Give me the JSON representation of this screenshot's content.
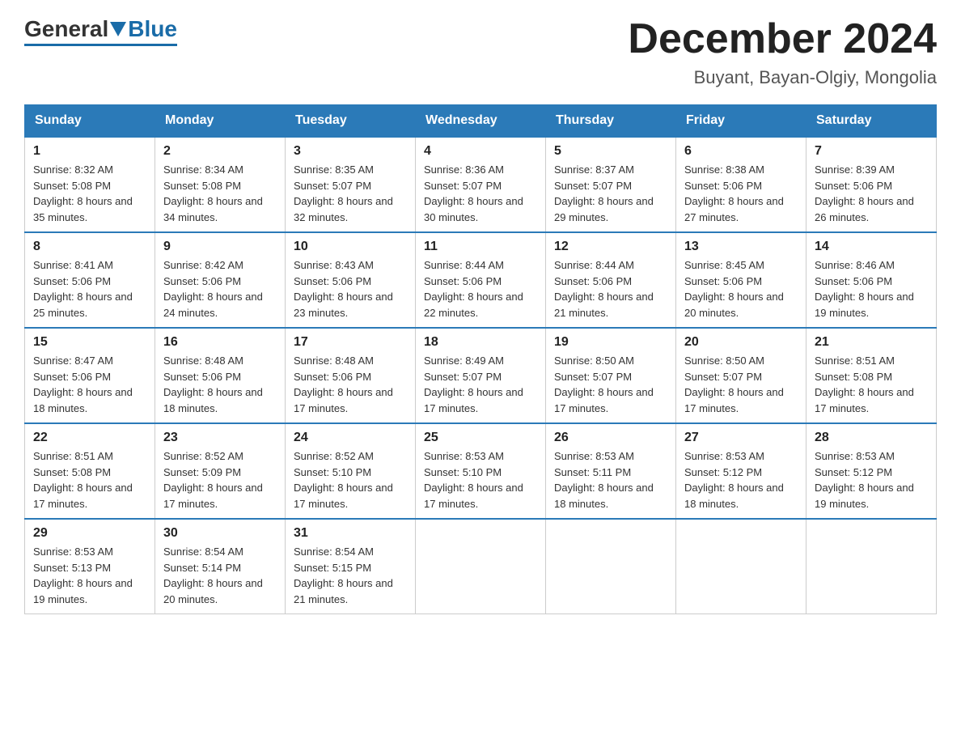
{
  "logo": {
    "general": "General",
    "blue": "Blue"
  },
  "title": "December 2024",
  "subtitle": "Buyant, Bayan-Olgiy, Mongolia",
  "days_of_week": [
    "Sunday",
    "Monday",
    "Tuesday",
    "Wednesday",
    "Thursday",
    "Friday",
    "Saturday"
  ],
  "weeks": [
    [
      {
        "day": "1",
        "sunrise": "8:32 AM",
        "sunset": "5:08 PM",
        "daylight": "8 hours and 35 minutes."
      },
      {
        "day": "2",
        "sunrise": "8:34 AM",
        "sunset": "5:08 PM",
        "daylight": "8 hours and 34 minutes."
      },
      {
        "day": "3",
        "sunrise": "8:35 AM",
        "sunset": "5:07 PM",
        "daylight": "8 hours and 32 minutes."
      },
      {
        "day": "4",
        "sunrise": "8:36 AM",
        "sunset": "5:07 PM",
        "daylight": "8 hours and 30 minutes."
      },
      {
        "day": "5",
        "sunrise": "8:37 AM",
        "sunset": "5:07 PM",
        "daylight": "8 hours and 29 minutes."
      },
      {
        "day": "6",
        "sunrise": "8:38 AM",
        "sunset": "5:06 PM",
        "daylight": "8 hours and 27 minutes."
      },
      {
        "day": "7",
        "sunrise": "8:39 AM",
        "sunset": "5:06 PM",
        "daylight": "8 hours and 26 minutes."
      }
    ],
    [
      {
        "day": "8",
        "sunrise": "8:41 AM",
        "sunset": "5:06 PM",
        "daylight": "8 hours and 25 minutes."
      },
      {
        "day": "9",
        "sunrise": "8:42 AM",
        "sunset": "5:06 PM",
        "daylight": "8 hours and 24 minutes."
      },
      {
        "day": "10",
        "sunrise": "8:43 AM",
        "sunset": "5:06 PM",
        "daylight": "8 hours and 23 minutes."
      },
      {
        "day": "11",
        "sunrise": "8:44 AM",
        "sunset": "5:06 PM",
        "daylight": "8 hours and 22 minutes."
      },
      {
        "day": "12",
        "sunrise": "8:44 AM",
        "sunset": "5:06 PM",
        "daylight": "8 hours and 21 minutes."
      },
      {
        "day": "13",
        "sunrise": "8:45 AM",
        "sunset": "5:06 PM",
        "daylight": "8 hours and 20 minutes."
      },
      {
        "day": "14",
        "sunrise": "8:46 AM",
        "sunset": "5:06 PM",
        "daylight": "8 hours and 19 minutes."
      }
    ],
    [
      {
        "day": "15",
        "sunrise": "8:47 AM",
        "sunset": "5:06 PM",
        "daylight": "8 hours and 18 minutes."
      },
      {
        "day": "16",
        "sunrise": "8:48 AM",
        "sunset": "5:06 PM",
        "daylight": "8 hours and 18 minutes."
      },
      {
        "day": "17",
        "sunrise": "8:48 AM",
        "sunset": "5:06 PM",
        "daylight": "8 hours and 17 minutes."
      },
      {
        "day": "18",
        "sunrise": "8:49 AM",
        "sunset": "5:07 PM",
        "daylight": "8 hours and 17 minutes."
      },
      {
        "day": "19",
        "sunrise": "8:50 AM",
        "sunset": "5:07 PM",
        "daylight": "8 hours and 17 minutes."
      },
      {
        "day": "20",
        "sunrise": "8:50 AM",
        "sunset": "5:07 PM",
        "daylight": "8 hours and 17 minutes."
      },
      {
        "day": "21",
        "sunrise": "8:51 AM",
        "sunset": "5:08 PM",
        "daylight": "8 hours and 17 minutes."
      }
    ],
    [
      {
        "day": "22",
        "sunrise": "8:51 AM",
        "sunset": "5:08 PM",
        "daylight": "8 hours and 17 minutes."
      },
      {
        "day": "23",
        "sunrise": "8:52 AM",
        "sunset": "5:09 PM",
        "daylight": "8 hours and 17 minutes."
      },
      {
        "day": "24",
        "sunrise": "8:52 AM",
        "sunset": "5:10 PM",
        "daylight": "8 hours and 17 minutes."
      },
      {
        "day": "25",
        "sunrise": "8:53 AM",
        "sunset": "5:10 PM",
        "daylight": "8 hours and 17 minutes."
      },
      {
        "day": "26",
        "sunrise": "8:53 AM",
        "sunset": "5:11 PM",
        "daylight": "8 hours and 18 minutes."
      },
      {
        "day": "27",
        "sunrise": "8:53 AM",
        "sunset": "5:12 PM",
        "daylight": "8 hours and 18 minutes."
      },
      {
        "day": "28",
        "sunrise": "8:53 AM",
        "sunset": "5:12 PM",
        "daylight": "8 hours and 19 minutes."
      }
    ],
    [
      {
        "day": "29",
        "sunrise": "8:53 AM",
        "sunset": "5:13 PM",
        "daylight": "8 hours and 19 minutes."
      },
      {
        "day": "30",
        "sunrise": "8:54 AM",
        "sunset": "5:14 PM",
        "daylight": "8 hours and 20 minutes."
      },
      {
        "day": "31",
        "sunrise": "8:54 AM",
        "sunset": "5:15 PM",
        "daylight": "8 hours and 21 minutes."
      },
      null,
      null,
      null,
      null
    ]
  ]
}
